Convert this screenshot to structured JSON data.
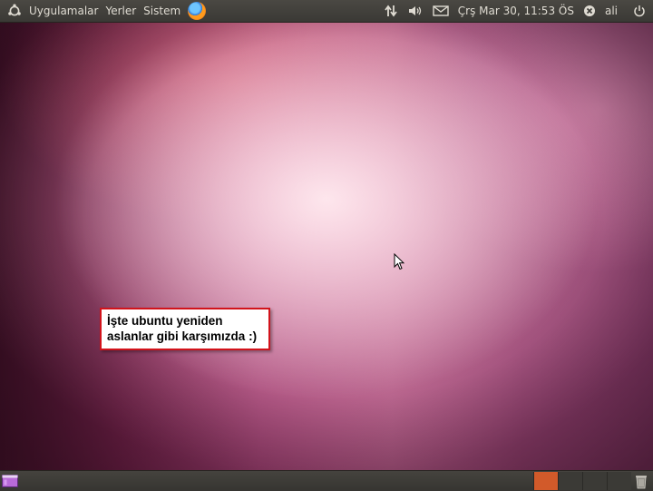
{
  "top_panel": {
    "menus": [
      "Uygulamalar",
      "Yerler",
      "Sistem"
    ],
    "clock": "Çrş Mar 30, 11:53 ÖS",
    "user": "ali",
    "icons": {
      "logo": "ubuntu-logo-icon",
      "browser": "firefox-icon",
      "network": "network-transfer-icon",
      "volume": "volume-icon",
      "mail": "envelope-icon",
      "user_status": "user-status-icon",
      "power": "power-icon"
    }
  },
  "callout": {
    "line1": "İşte ubuntu yeniden",
    "line2": "aslanlar gibi karşımızda :)",
    "border_color": "#d2131b"
  },
  "bottom_panel": {
    "workspace_count": 4,
    "active_workspace": 1,
    "accent_color": "#d25a2a",
    "icons": {
      "show_desktop": "show-desktop-icon",
      "trash": "trash-icon"
    }
  }
}
